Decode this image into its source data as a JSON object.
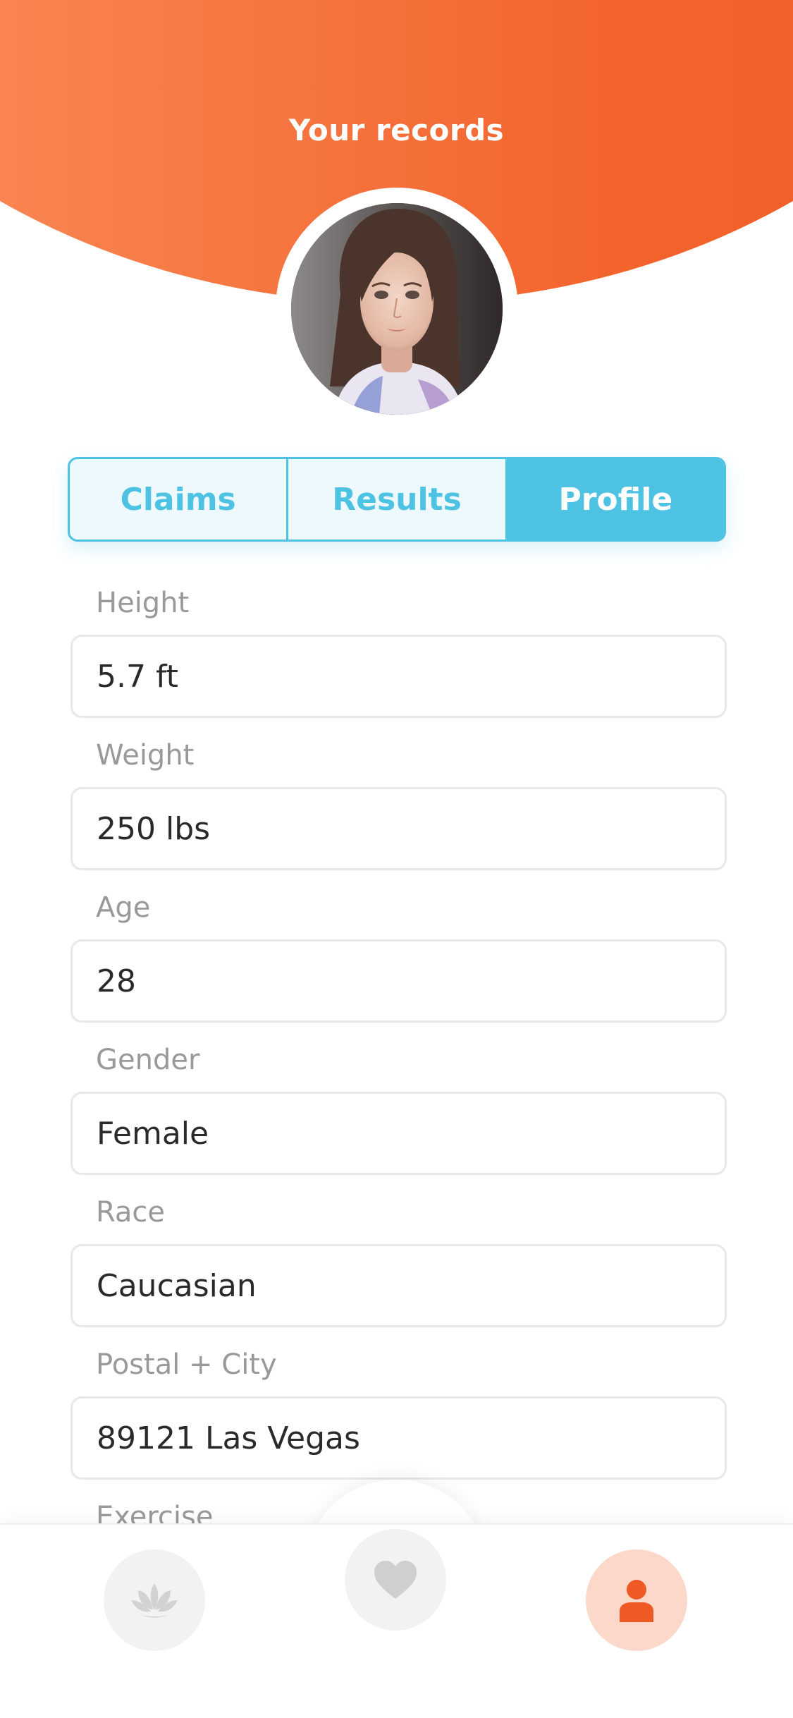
{
  "header": {
    "title": "Your records"
  },
  "avatar": {
    "alt": "profile photo"
  },
  "tabs": [
    {
      "label": "Claims",
      "active": false
    },
    {
      "label": "Results",
      "active": false
    },
    {
      "label": "Profile",
      "active": true
    }
  ],
  "fields": [
    {
      "label": "Height",
      "value": "5.7 ft"
    },
    {
      "label": "Weight",
      "value": "250 lbs"
    },
    {
      "label": "Age",
      "value": "28"
    },
    {
      "label": "Gender",
      "value": "Female"
    },
    {
      "label": "Race",
      "value": "Caucasian"
    },
    {
      "label": "Postal + City",
      "value": "89121 Las Vegas"
    },
    {
      "label": "Exercise",
      "value": ""
    }
  ],
  "tabbar": {
    "items": [
      {
        "icon": "lotus-icon",
        "active": false
      },
      {
        "icon": "heart-icon",
        "active": false
      },
      {
        "icon": "user-icon",
        "active": true
      }
    ]
  },
  "colors": {
    "accent_orange": "#ef5a24",
    "accent_blue": "#4ec2e2"
  }
}
